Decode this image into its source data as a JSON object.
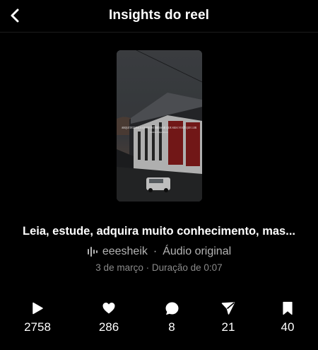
{
  "header": {
    "title": "Insights do reel",
    "back_icon": "chevron-left-icon"
  },
  "reel": {
    "overlay_text": "ARQUITETURA A QUEM INTERESSAR QUE SEJA VOCÊ QUE LER",
    "overlay_credit": "Créditos Felipe Ribeiro",
    "caption": "Leia, estude, adquira muito conhecimento, mas...",
    "audio": {
      "account": "eeesheik",
      "separator": "·",
      "label": "Áudio original",
      "icon": "audio-wave-icon"
    },
    "date": "3 de março",
    "duration": "Duração de 0:07"
  },
  "stats": [
    {
      "name": "plays",
      "icon": "play-icon",
      "value": "2758"
    },
    {
      "name": "likes",
      "icon": "heart-icon",
      "value": "286"
    },
    {
      "name": "comments",
      "icon": "comment-icon",
      "value": "8"
    },
    {
      "name": "shares",
      "icon": "send-icon",
      "value": "21"
    },
    {
      "name": "saves",
      "icon": "bookmark-icon",
      "value": "40"
    }
  ]
}
